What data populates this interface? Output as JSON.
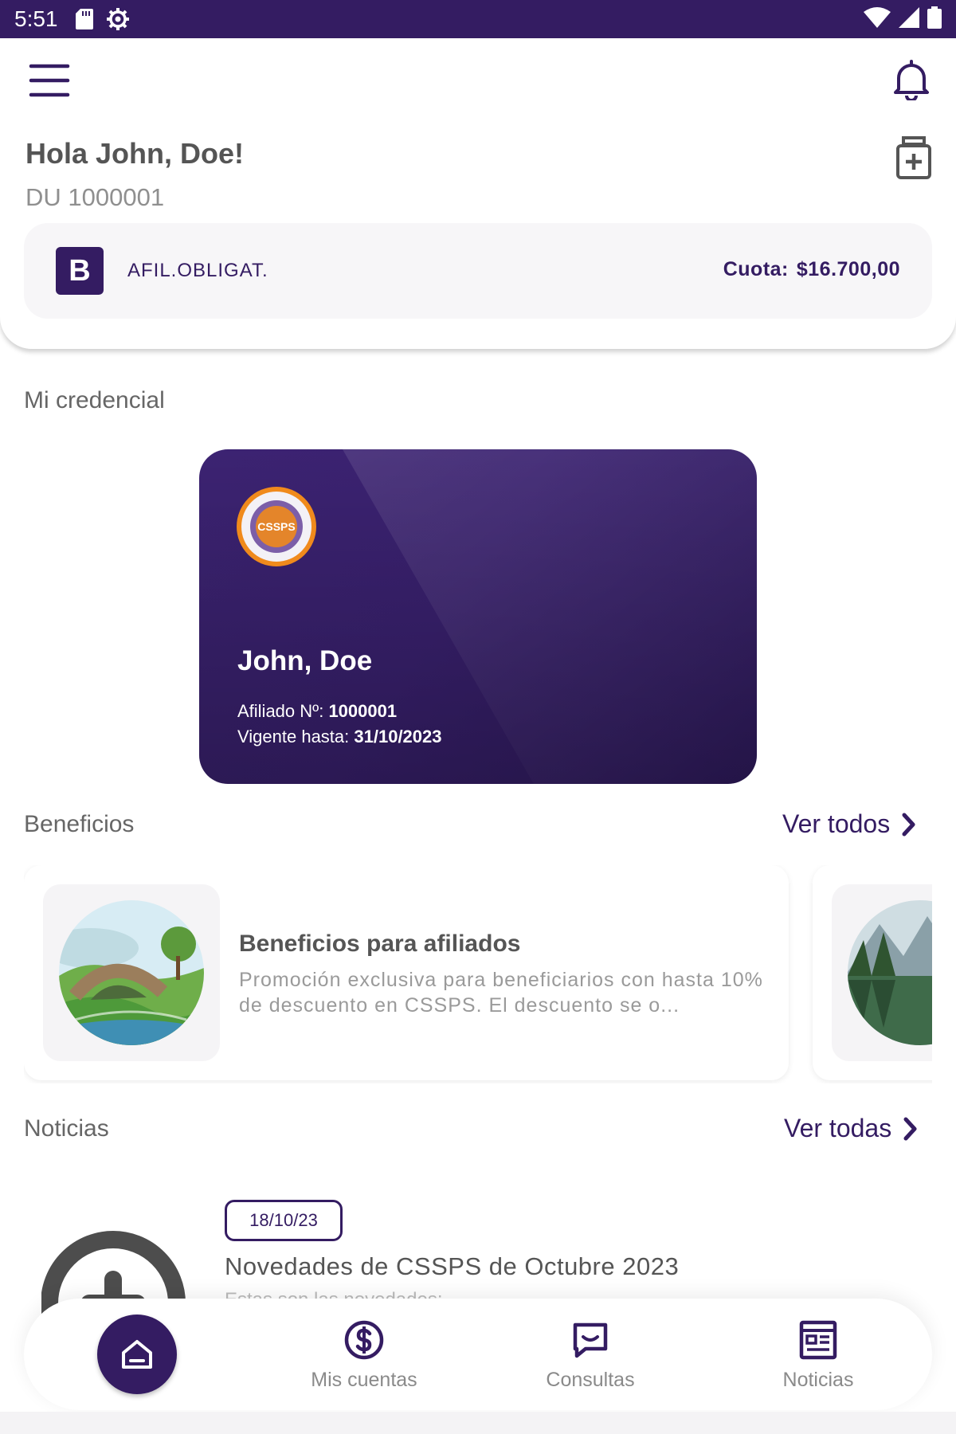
{
  "status_bar": {
    "time": "5:51"
  },
  "header": {
    "greeting": "Hola John, Doe!",
    "document": "DU 1000001",
    "plan": {
      "badge": "B",
      "name": "AFIL.OBLIGAT.",
      "fee_label": "Cuota:",
      "fee_value": "$16.700,00"
    }
  },
  "credential_section": {
    "title": "Mi credencial",
    "card": {
      "logo_text": "CSSPS",
      "holder_name": "John, Doe",
      "member_label": "Afiliado Nº:",
      "member_number": "1000001",
      "valid_label": "Vigente hasta:",
      "valid_until": "31/10/2023"
    }
  },
  "benefits_section": {
    "title": "Beneficios",
    "see_all": "Ver todos",
    "items": [
      {
        "title": "Beneficios para afiliados",
        "text": "Promoción exclusiva para beneficiarios con hasta 10% de descuento en CSSPS. El descuento se o..."
      }
    ]
  },
  "news_section": {
    "title": "Noticias",
    "see_all": "Ver todas",
    "items": [
      {
        "date": "18/10/23",
        "title": "Novedades de CSSPS de Octubre 2023",
        "snippet": "Estas son las novedades:"
      }
    ]
  },
  "bottom_nav": {
    "items": [
      {
        "label": "Mis cuentas",
        "icon": "dollar-circle-icon"
      },
      {
        "label": "Consultas",
        "icon": "chat-icon"
      },
      {
        "label": "Noticias",
        "icon": "newspaper-icon"
      }
    ]
  },
  "colors": {
    "primary": "#341c62",
    "status_bar": "#341c62",
    "text_muted": "#8f8f8f"
  }
}
